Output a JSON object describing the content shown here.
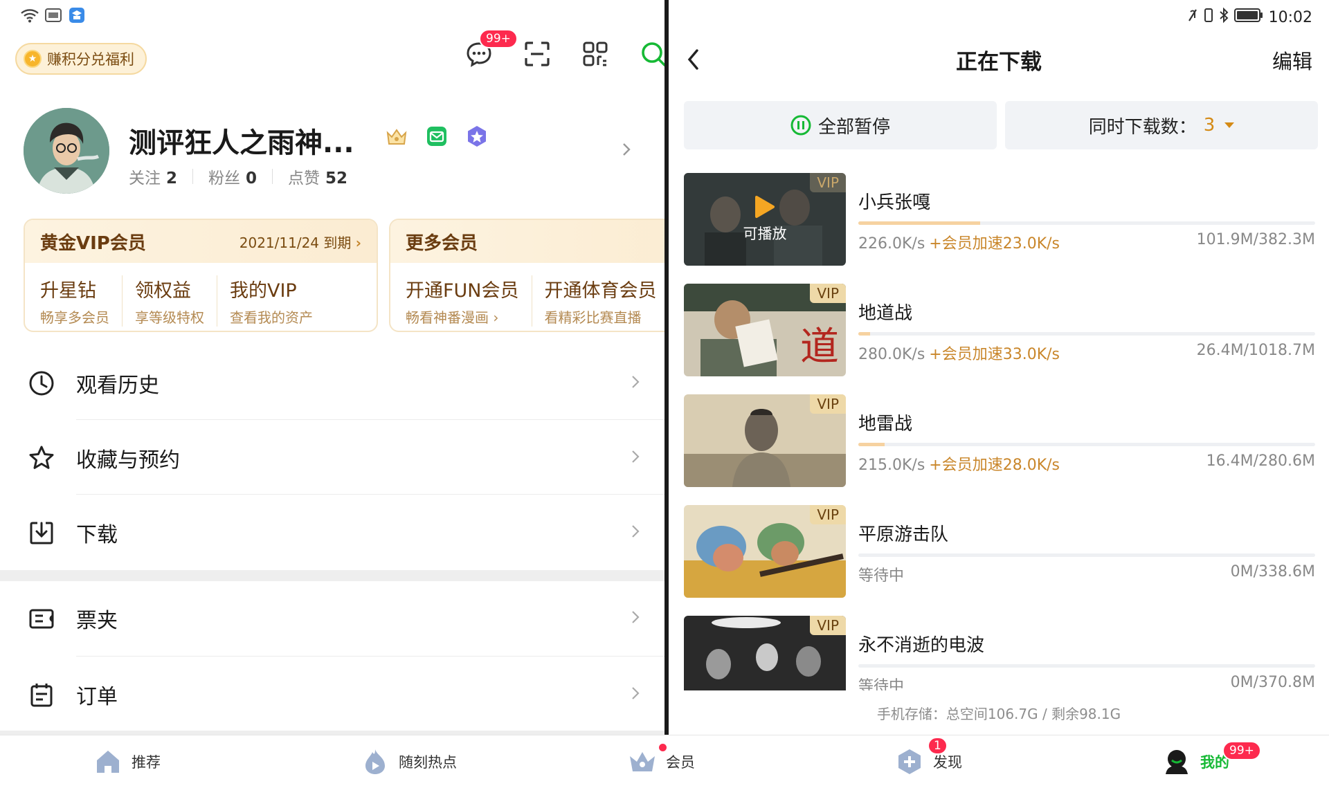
{
  "left": {
    "earn_pill": "赚积分兑福利",
    "message_badge": "99+",
    "profile": {
      "username": "测评狂人之雨神...",
      "follow_label": "关注",
      "follow_count": "2",
      "fans_label": "粉丝",
      "fans_count": "0",
      "likes_label": "点赞",
      "likes_count": "52"
    },
    "gold_vip": {
      "title": "黄金VIP会员",
      "expiry": "2021/11/24 到期",
      "items": [
        {
          "title": "升星钻",
          "sub": "畅享多会员"
        },
        {
          "title": "领权益",
          "sub": "享等级特权"
        },
        {
          "title": "我的VIP",
          "sub": "查看我的资产"
        }
      ]
    },
    "more_vip": {
      "title": "更多会员",
      "items": [
        {
          "title": "开通FUN会员",
          "sub": "畅看神番漫画 ›"
        },
        {
          "title": "开通体育会员",
          "sub": "看精彩比赛直播"
        }
      ]
    },
    "menu": [
      {
        "label": "观看历史",
        "icon": "clock-icon"
      },
      {
        "label": "收藏与预约",
        "icon": "star-icon"
      },
      {
        "label": "下载",
        "icon": "download-icon"
      },
      {
        "label": "票夹",
        "icon": "ticket-icon"
      },
      {
        "label": "订单",
        "icon": "order-icon"
      }
    ]
  },
  "right": {
    "status_time": "10:02",
    "title": "正在下载",
    "edit": "编辑",
    "pause_all": "全部暂停",
    "concurrent_label": "同时下载数：",
    "concurrent_value": "3",
    "playable_label": "可播放",
    "vip_tag": "VIP",
    "downloads": [
      {
        "title": "小兵张嘎",
        "speed": "226.0K/s",
        "boost": "+会员加速23.0K/s",
        "size": "101.9M/382.3M",
        "progress": 0.266
      },
      {
        "title": "地道战",
        "speed": "280.0K/s",
        "boost": "+会员加速33.0K/s",
        "size": "26.4M/1018.7M",
        "progress": 0.026
      },
      {
        "title": "地雷战",
        "speed": "215.0K/s",
        "boost": "+会员加速28.0K/s",
        "size": "16.4M/280.6M",
        "progress": 0.058
      },
      {
        "title": "平原游击队",
        "speed": "等待中",
        "boost": "",
        "size": "0M/338.6M",
        "progress": 0
      },
      {
        "title": "永不消逝的电波",
        "speed": "等待中",
        "boost": "",
        "size": "0M/370.8M",
        "progress": 0
      }
    ],
    "storage": "手机存储：总空间106.7G / 剩余98.1G"
  },
  "tabbar": {
    "tabs": [
      {
        "label": "推荐",
        "icon": "home-icon"
      },
      {
        "label": "随刻热点",
        "icon": "flame-icon"
      },
      {
        "label": "会员",
        "icon": "crown-icon"
      },
      {
        "label": "发现",
        "icon": "discover-icon",
        "badge": "1"
      },
      {
        "label": "我的",
        "icon": "profile-icon",
        "badge": "99+"
      }
    ],
    "active": "我的"
  }
}
